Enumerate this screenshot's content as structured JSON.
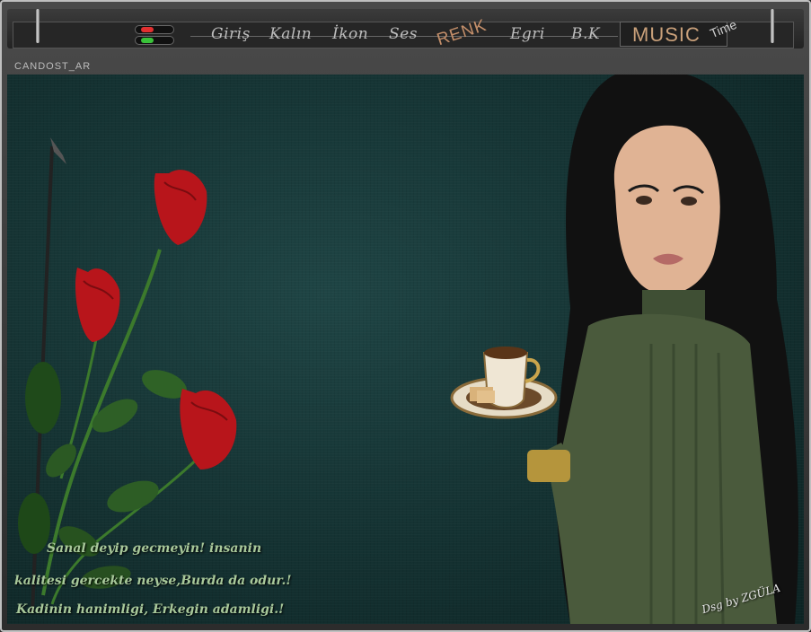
{
  "header": {
    "menu": [
      "Giriş",
      "Kalın",
      "İkon",
      "Ses",
      "RENK",
      "Egri",
      "B.K"
    ],
    "music_label": "MUSIC",
    "time_label": "Time",
    "brand": "CANDOST_AR"
  },
  "toggle": {
    "top_color": "#e23030",
    "bottom_color": "#39c239"
  },
  "quote": {
    "line1": "Sanal deyip gecmeyin! insanin",
    "line2": "kalitesi gercekte neyse,Burda da odur.!",
    "line3": "Kadinin hanimligi, Erkegin adamligi.!"
  },
  "signature": "Dsg by ZGÜLA",
  "colors": {
    "accent": "#c48f6a",
    "background": "#163535",
    "quote_text": "#a8c89a"
  },
  "icons": {
    "toggle": "toggle-switch-icon"
  }
}
